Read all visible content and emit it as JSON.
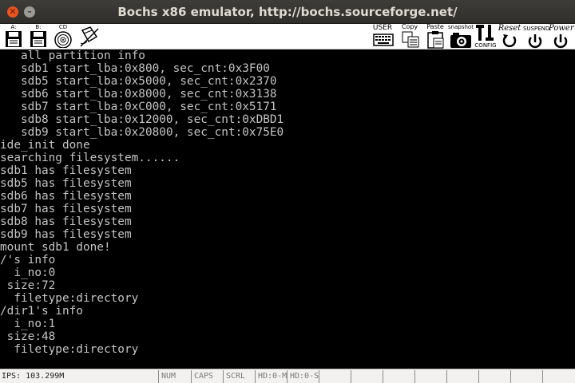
{
  "window": {
    "title": "Bochs x86 emulator, http://bochs.sourceforge.net/",
    "close_glyph": "✕",
    "minimize_glyph": "–"
  },
  "toolbar": {
    "floppy_a": "A:",
    "floppy_b": "B:",
    "cdrom": "CD",
    "user": "USER",
    "copy": "Copy",
    "paste": "Paste",
    "snapshot": "snapshot",
    "config": "CONFIG",
    "reset": "Reset",
    "suspend": "SUSPEND",
    "power": "Power"
  },
  "console": {
    "lines": [
      "   all partition info",
      "   sdb1 start_lba:0x800, sec_cnt:0x3F00",
      "   sdb5 start_lba:0x5000, sec_cnt:0x2370",
      "   sdb6 start_lba:0x8000, sec_cnt:0x3138",
      "   sdb7 start_lba:0xC000, sec_cnt:0x5171",
      "   sdb8 start_lba:0x12000, sec_cnt:0xDBD1",
      "   sdb9 start_lba:0x20800, sec_cnt:0x75E0",
      "ide_init done",
      "searching filesystem......",
      "sdb1 has filesystem",
      "sdb5 has filesystem",
      "sdb6 has filesystem",
      "sdb7 has filesystem",
      "sdb8 has filesystem",
      "sdb9 has filesystem",
      "mount sdb1 done!",
      "/'s info",
      "  i_no:0",
      " size:72",
      "  filetype:directory",
      "/dir1's info",
      "  i_no:1",
      " size:48",
      "  filetype:directory"
    ]
  },
  "statusbar": {
    "ips": "IPS: 103.299M",
    "num": "NUM",
    "caps": "CAPS",
    "scrl": "SCRL",
    "hd0m": "HD:0-M",
    "hd0s": "HD:0-S"
  },
  "colors": {
    "console_text": "#c4c4c4",
    "console_bg": "#000000",
    "close_button": "#e95420"
  }
}
